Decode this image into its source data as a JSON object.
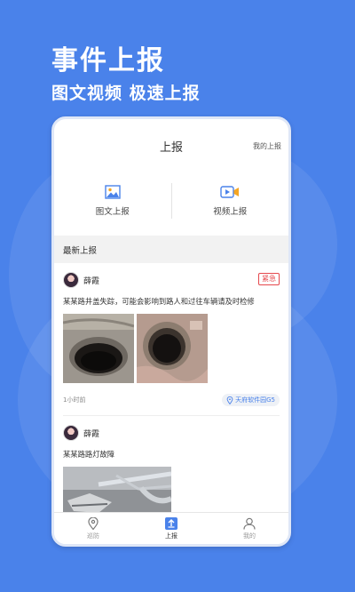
{
  "hero": {
    "title": "事件上报",
    "subtitle": "图文视频  极速上报"
  },
  "topbar": {
    "title": "上报",
    "my_reports": "我的上报"
  },
  "entries": [
    {
      "label": "图文上报",
      "icon": "image-report-icon"
    },
    {
      "label": "视频上报",
      "icon": "video-report-icon"
    }
  ],
  "section": {
    "title": "最新上报"
  },
  "posts": [
    {
      "user": "薛霞",
      "badge": "紧急",
      "text": "某某路井盖失踪，可能会影响到路人和过往车辆请及时检修",
      "time": "1小时前",
      "location": "天府软件园G5"
    },
    {
      "user": "薛霞",
      "text": "某某路路灯故障"
    }
  ],
  "tabs": [
    {
      "label": "巡防",
      "icon": "location-pin-icon"
    },
    {
      "label": "上报",
      "icon": "upload-icon",
      "active": true
    },
    {
      "label": "我的",
      "icon": "user-icon"
    }
  ],
  "colors": {
    "brand": "#4a82ea",
    "urgent": "#e5484d"
  }
}
